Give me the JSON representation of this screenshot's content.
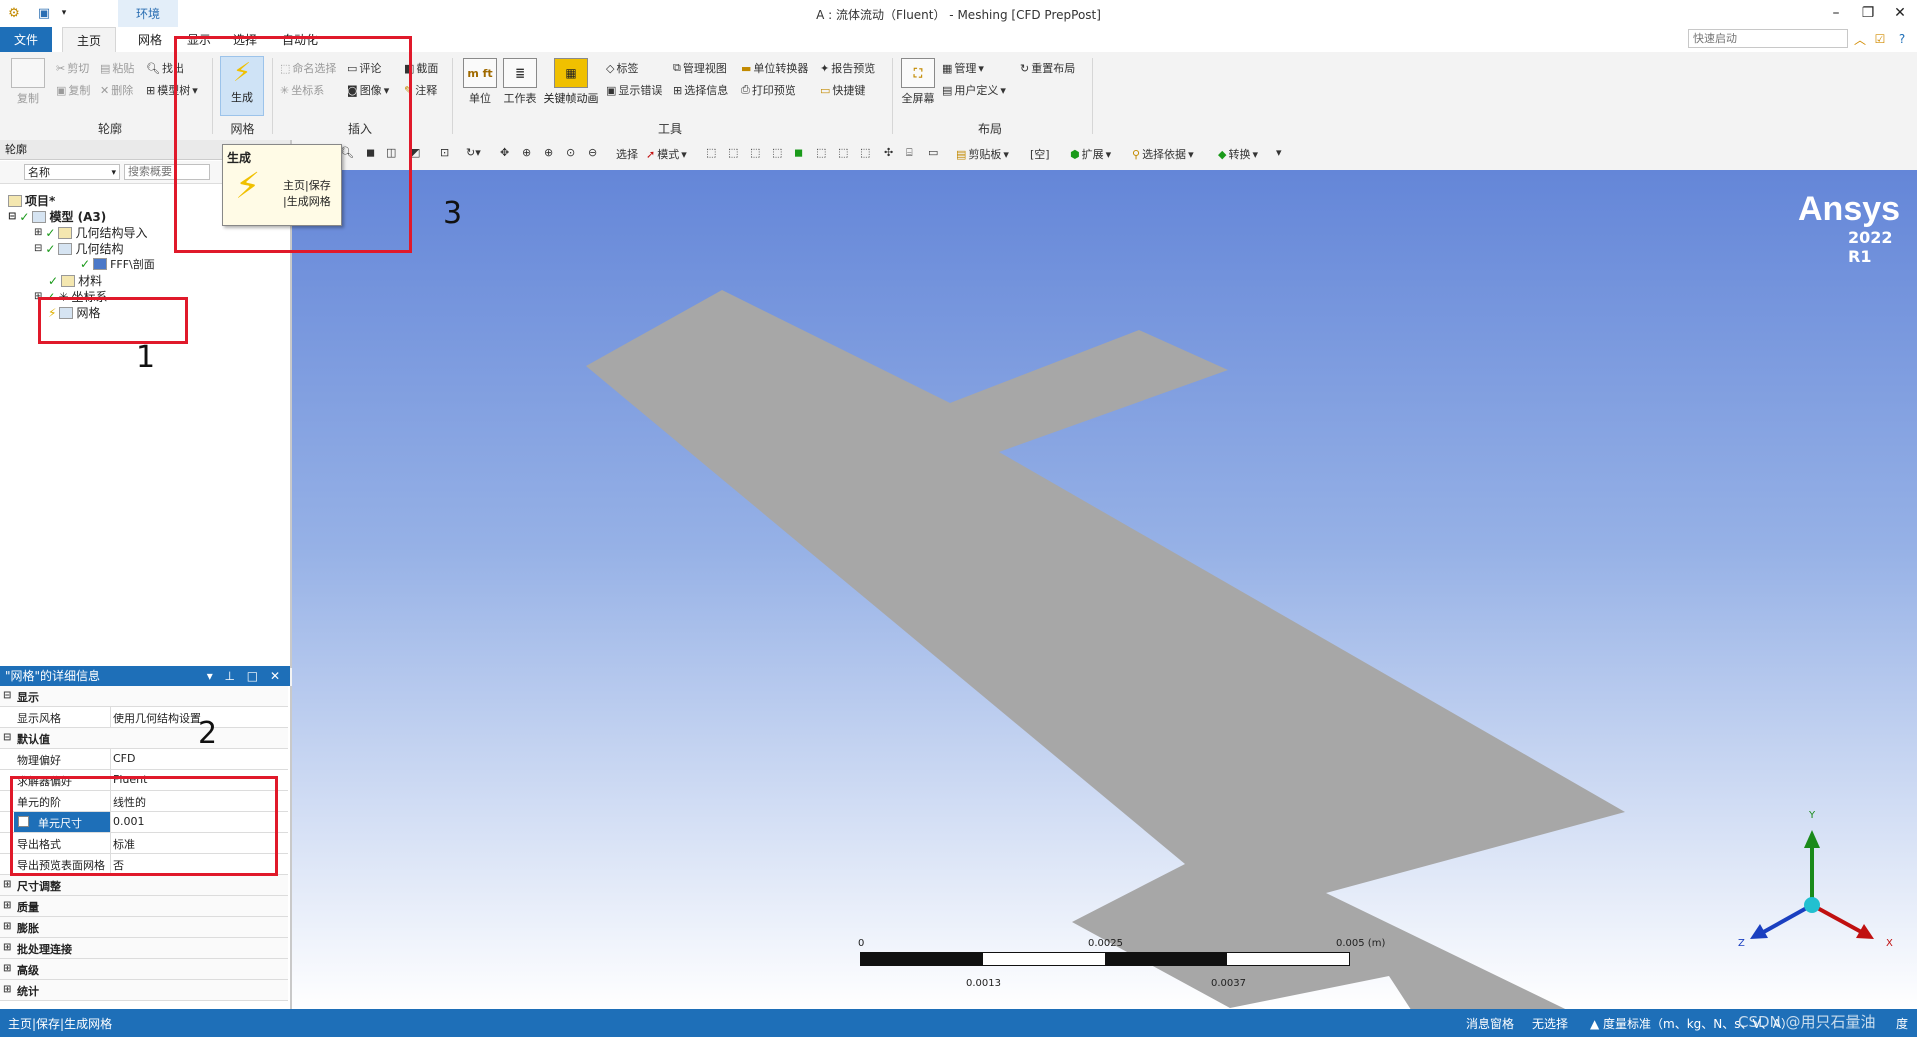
{
  "titlebar": {
    "title": "A : 流体流动（Fluent） - Meshing [CFD PrepPost]",
    "context_tab": "环境"
  },
  "tabs": {
    "file": "文件",
    "home": "主页",
    "mesh": "网格",
    "display": "显示",
    "selection": "选择",
    "automation": "自动化"
  },
  "quick_launch": {
    "placeholder": "快速启动"
  },
  "ribbon": {
    "outline": {
      "label": "轮廓",
      "copy": "复制",
      "cut": "剪切",
      "paste": "粘贴",
      "find": "找出",
      "duplicate": "复制",
      "delete": "删除",
      "tree": "模型树"
    },
    "mesh": {
      "label": "网格",
      "generate": "生成"
    },
    "insert": {
      "label": "插入",
      "named_selection": "命名选择",
      "coordinate": "坐标系",
      "comment": "评论",
      "image": "图像",
      "section": "截面",
      "annotation": "注释"
    },
    "tools": {
      "label": "工具",
      "units": "单位",
      "worksheet": "工作表",
      "keyframe": "关键帧动画",
      "tag": "标签",
      "show_errors": "显示错误",
      "manage_views": "管理视图",
      "selection_info": "选择信息",
      "unit_converter": "单位转换器",
      "print_preview": "打印预览",
      "report_preview": "报告预览",
      "shortcuts": "快捷键"
    },
    "layout": {
      "label": "布局",
      "fullscreen": "全屏幕",
      "manage": "管理",
      "user_defined": "用户定义",
      "reset_layout": "重置布局"
    }
  },
  "tooltip": {
    "title": "生成",
    "line1": "主页|保存",
    "line2": "|生成网格"
  },
  "outline": {
    "header": "轮廓",
    "filter_name": "名称",
    "search_placeholder": "搜索概要",
    "tree": {
      "project": "项目*",
      "model": "模型 (A3)",
      "geometry_import": "几何结构导入",
      "geometry": "几何结构",
      "body": "FFF\\剖面",
      "materials": "材料",
      "coordinates": "坐标系",
      "mesh": "网格"
    }
  },
  "details": {
    "header": "\"网格\"的详细信息",
    "rows": [
      {
        "key": "显示",
        "cat": true
      },
      {
        "key": "显示风格",
        "value": "使用几何结构设置"
      },
      {
        "key": "默认值",
        "cat": true
      },
      {
        "key": "物理偏好",
        "value": "CFD"
      },
      {
        "key": "求解器偏好",
        "value": "Fluent"
      },
      {
        "key": "单元的阶",
        "value": "线性的"
      },
      {
        "key": "单元尺寸",
        "value": "0.001"
      },
      {
        "key": "导出格式",
        "value": "标准"
      },
      {
        "key": "导出预览表面网格",
        "value": "否"
      },
      {
        "key": "尺寸调整",
        "cat": true
      },
      {
        "key": "质量",
        "cat": true
      },
      {
        "key": "膨胀",
        "cat": true
      },
      {
        "key": "批处理连接",
        "cat": true
      },
      {
        "key": "高级",
        "cat": true
      },
      {
        "key": "统计",
        "cat": true
      }
    ]
  },
  "viewport_toolbar": {
    "select": "选择",
    "mode": "模式",
    "clipboard": "剪贴板",
    "empty": "[空]",
    "extend": "扩展",
    "select_by": "选择依据",
    "convert": "转换"
  },
  "viewport": {
    "brand": "Ansys",
    "version": "2022 R1",
    "scale": {
      "t0": "0",
      "t1": "0.0025",
      "t2": "0.005 (m)",
      "b1": "0.0013",
      "b2": "0.0037"
    },
    "axes": {
      "x": "X",
      "y": "Y",
      "z": "Z"
    }
  },
  "annotations": {
    "n1": "1",
    "n2": "2",
    "n3": "3"
  },
  "status": {
    "left": "主页|保存|生成网格",
    "messages": "消息窗格",
    "selection": "无选择",
    "units": "度量标准（m、kg、N、s、V、A）",
    "extra": "度",
    "watermark": "CSDN @用只石量油"
  },
  "colors": {
    "accent": "#1e6fb8",
    "annotation": "#e0192a",
    "model": "#a7a7a7"
  }
}
